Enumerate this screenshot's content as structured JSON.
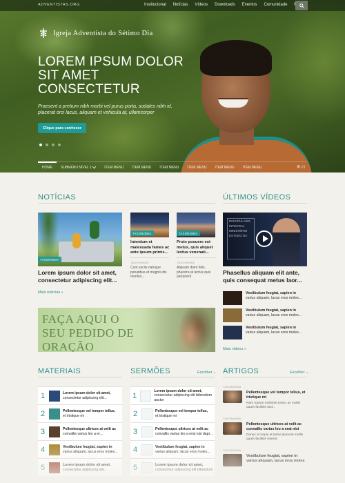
{
  "topbar": {
    "site": "ADVENTISTAS.ORG",
    "nav": [
      "Institucional",
      "Notícias",
      "Vídeos",
      "Downloads",
      "Eventos",
      "Comunidade",
      "Mais..."
    ]
  },
  "hero": {
    "logo_text": "Igreja Adventista do Sétimo Dia",
    "title": "LOREM IPSUM DOLOR SIT AMET CONSECTETUR",
    "subtitle": "Praesent a pretium nibh morbi vel purus porta, sodales nibh id, placerat orci lacus, aliquam et vehicula at, ullamcorper",
    "button": "Clique para conhecer",
    "slides": 4,
    "active_slide": 1
  },
  "menu": {
    "items": [
      "HOME",
      "SUBMENU NÍVEL 1",
      "ITEM MENU",
      "ITEM MENU",
      "ITEM MENU",
      "ITEM MENU",
      "ITEM MENU",
      "ITEM MENU"
    ],
    "lang": "PT"
  },
  "noticias": {
    "heading": "NOTÍCIAS",
    "main": {
      "tag": "TAXONOMIA",
      "title": "Lorem ipsum dolor sit amet, consectetur adipiscing elit..."
    },
    "small": [
      {
        "tag": "TAXONOMIA",
        "title": "Interdum et malesuada fames ac ante ipsum primis...",
        "tax": "TAXONOMIA",
        "text": "Cum sociis natoque penatibus et magnis dis montes..."
      },
      {
        "tag": "TAXONOMIA",
        "title": "Proin posuere est metus, quis aliquet lectus venenati...",
        "tax": "TAXONOMIA",
        "text": "Aliquam diam felis, pharetra at lectus quis parturient"
      }
    ],
    "more": "Mais notícias »"
  },
  "banner": {
    "text": "FAÇA AQUI O SEU PEDIDO DE ORAÇÃO"
  },
  "videos": {
    "heading": "ÚLTIMOS VÍDEOS",
    "main_panel": [
      "DISCIPULADO",
      "INTEGRAL",
      "MINISTÉRIO",
      "ESTUDO DA"
    ],
    "main_title": "Phasellus aliquam elit ante, quis consequat metus laor...",
    "items": [
      {
        "title": "Vestibulum feugiat, sapien in",
        "text": "varius aliquam, lacus eros moles...",
        "color": "#2a1e14"
      },
      {
        "title": "Vestibulum feugiat, sapien in",
        "text": "varius aliquam, lacus eros moles...",
        "color": "#8a6a38"
      },
      {
        "title": "Vestibulum feugiat, sapien in",
        "text": "varius aliquam, lacus eros moles...",
        "color": "#23314f"
      }
    ],
    "more": "Mais vídeos »"
  },
  "materiais": {
    "heading": "MATERIAIS",
    "items": [
      {
        "num": "1",
        "title": "Lorem ipsum dolor sit amet,",
        "text": "consectetur adipiscing elit...",
        "color": "#2b4a7a"
      },
      {
        "num": "2",
        "title": "Pellentesque vel tempor tellus,",
        "text": "et tristique mi",
        "color": "#3a8f8a"
      },
      {
        "num": "3",
        "title": "Pellentesque ultrices at velit ac",
        "text": "convallis varius leo a er...",
        "color": "#5a3f2c"
      },
      {
        "num": "4",
        "title": "Vestibulum feugiat, sapien in",
        "text": "varius aliquam, lacus eros moles...",
        "color": "#a8862e"
      },
      {
        "num": "5",
        "title": "Lorem ipsum dolor sit amet,",
        "text": "consectetur adipiscing elit...",
        "color": "#9a3f2c"
      }
    ]
  },
  "sermoes": {
    "heading": "SERMÕES",
    "choose": "Escolher ⌄",
    "items": [
      {
        "num": "1",
        "title": "Lorem ipsum dolor sit amet,",
        "text": "consectetur adipiscing elit bibendum auctor"
      },
      {
        "num": "2",
        "title": "Pellentesque vel tempor tellus,",
        "text": "et tristique mi"
      },
      {
        "num": "3",
        "title": "Pellentesque ultrices at velit ac",
        "text": "convallis varius leo a erat nisi dapi..."
      },
      {
        "num": "4",
        "title": "Vestibulum feugiat, sapien in",
        "text": "varius aliquam, lacus eros moles..."
      },
      {
        "num": "5",
        "title": "Lorem ipsum dolor sit amet,",
        "text": "consectetur adipiscing elit bibendum"
      }
    ]
  },
  "artigos": {
    "heading": "ARTIGOS",
    "choose": "Escolher ⌄",
    "items": [
      {
        "tax": "TAXONOMIA",
        "title": "Pellentesque vel tempor tellus, et tristique mi",
        "text": "Nam rutrum molestie tortor, ac mollis quam facilisis sed...",
        "color": "#c9a07c"
      },
      {
        "tax": "TAXONOMIA",
        "title": "Pellentesque ultrices at velit ac convallis varius leo a erat nisi",
        "text": "Donec et turpis et tortor placerat mollis quam facilisis viverra",
        "color": "#b58a62"
      },
      {
        "tax": "TAXONOMIA",
        "title": "Vestibulum feugiat, sapien in varius aliquam, lacus eros moles",
        "text": "",
        "color": "#7a5a44"
      }
    ]
  },
  "colors": {
    "accent": "#2f8f8a",
    "button": "#1f9a96",
    "background": "#f3f1ec"
  }
}
